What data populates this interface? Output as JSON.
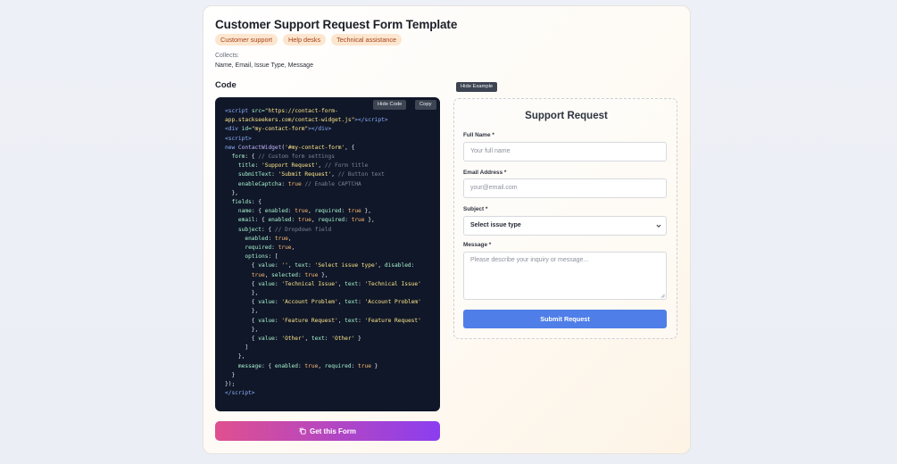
{
  "template": {
    "title": "Customer Support Request Form Template",
    "tags": [
      "Customer support",
      "Help desks",
      "Technical assistance"
    ],
    "collects_label": "Collects:",
    "collects_value": "Name, Email, Issue Type, Message",
    "code_heading": "Code",
    "hide_code_label": "Hide Code",
    "copy_label": "Copy",
    "get_form_label": "Get this Form",
    "hide_example_label": "Hide Example"
  },
  "preview": {
    "title": "Support Request",
    "full_name_label": "Full Name *",
    "full_name_placeholder": "Your full name",
    "email_label": "Email Address *",
    "email_placeholder": "your@email.com",
    "subject_label": "Subject *",
    "subject_value": "Select issue type",
    "message_label": "Message *",
    "message_placeholder": "Please describe your inquiry or message...",
    "submit_label": "Submit Request"
  },
  "icons": {
    "copy": "copy-icon",
    "chevron": "chevron-down-icon"
  },
  "colors": {
    "accent": "#4f7ee8",
    "tag_bg": "#fde6cf",
    "tag_text": "#a4431a",
    "code_bg": "#101728",
    "gradient_start": "#e0508f",
    "gradient_end": "#8b3ef0"
  }
}
